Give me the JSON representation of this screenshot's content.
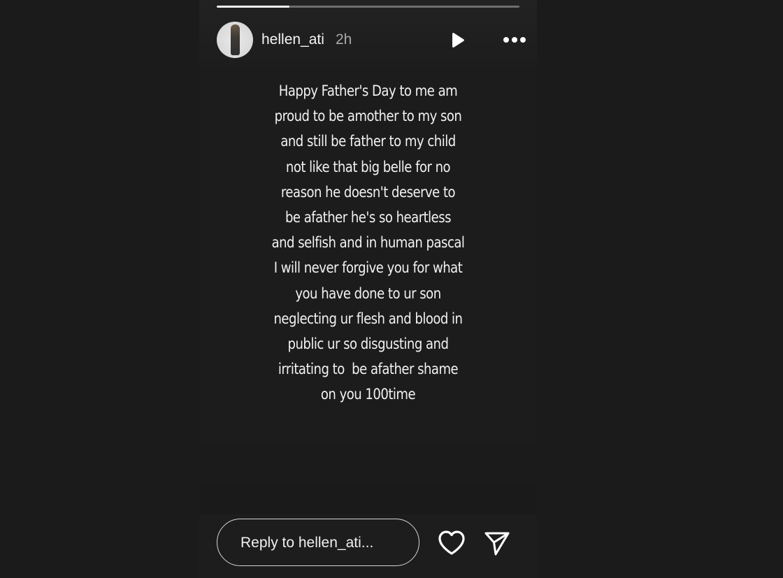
{
  "story": {
    "progress": 0.24,
    "author": {
      "username": "hellen_ati",
      "time_ago": "2h",
      "avatar": "avatar-photo"
    },
    "controls": {
      "play_icon": "play-icon",
      "more_icon": "more-options-icon"
    },
    "text_lines": [
      "Happy Father's Day to me am",
      "proud to be amother to my son",
      "and still be father to my child",
      "not like that big belle for no",
      "reason he doesn't deserve to",
      "be afather he's so heartless",
      "and selfish and in human pascal",
      "I will never forgive you for what",
      "you have done to ur son",
      "neglecting ur flesh and blood in",
      "public ur so disgusting and",
      "irritating to  be afather shame",
      "on you 100time"
    ]
  },
  "footer": {
    "reply_placeholder": "Reply to hellen_ati...",
    "like_icon": "heart-icon",
    "share_icon": "send-icon"
  },
  "colors": {
    "background": "#1b1b1b",
    "text": "#f2f2f2",
    "muted_text": "#a8a8a8",
    "progress_fill": "#f5f5f5"
  }
}
